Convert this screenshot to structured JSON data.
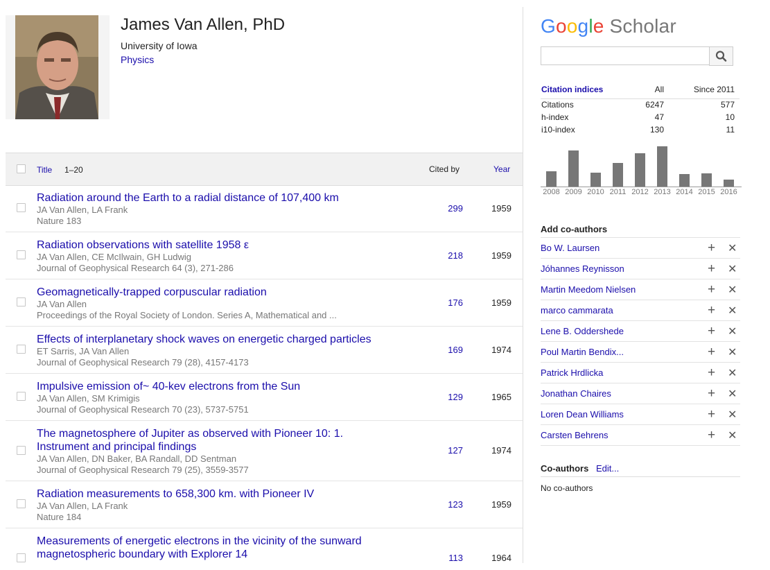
{
  "profile": {
    "name": "James Van Allen",
    "suffix": ", PhD",
    "affiliation": "University of Iowa",
    "field": "Physics"
  },
  "table_header": {
    "title": "Title",
    "range": "1–20",
    "cited_by": "Cited by",
    "year": "Year"
  },
  "articles": [
    {
      "title": "Radiation around the Earth to a radial distance of 107,400 km",
      "authors": "JA Van Allen, LA Frank",
      "venue": "Nature 183",
      "cited": "299",
      "year": "1959"
    },
    {
      "title": "Radiation observations with satellite 1958 ε",
      "authors": "JA Van Allen, CE McIlwain, GH Ludwig",
      "venue": "Journal of Geophysical Research 64 (3), 271-286",
      "cited": "218",
      "year": "1959"
    },
    {
      "title": "Geomagnetically-trapped corpuscular radiation",
      "authors": "JA Van Allen",
      "venue": "Proceedings of the Royal Society of London. Series A, Mathematical and ...",
      "cited": "176",
      "year": "1959"
    },
    {
      "title": "Effects of interplanetary shock waves on energetic charged particles",
      "authors": "ET Sarris, JA Van Allen",
      "venue": "Journal of Geophysical Research 79 (28), 4157-4173",
      "cited": "169",
      "year": "1974"
    },
    {
      "title": "Impulsive emission of~ 40-kev electrons from the Sun",
      "authors": "JA Van Allen, SM Krimigis",
      "venue": "Journal of Geophysical Research 70 (23), 5737-5751",
      "cited": "129",
      "year": "1965"
    },
    {
      "title": "The magnetosphere of Jupiter as observed with Pioneer 10: 1. Instrument and principal findings",
      "authors": "JA Van Allen, DN Baker, BA Randall, DD Sentman",
      "venue": "Journal of Geophysical Research 79 (25), 3559-3577",
      "cited": "127",
      "year": "1974"
    },
    {
      "title": "Radiation measurements to 658,300 km. with Pioneer IV",
      "authors": "JA Van Allen, LA Frank",
      "venue": "Nature 184",
      "cited": "123",
      "year": "1959"
    },
    {
      "title": "Measurements of energetic electrons in the vicinity of the sunward magnetospheric boundary with Explorer 14",
      "authors": "",
      "venue": "",
      "cited": "113",
      "year": "1964"
    }
  ],
  "logo": {
    "google": "Google",
    "scholar": "Scholar"
  },
  "search": {
    "placeholder": ""
  },
  "citation_indices": {
    "heading": "Citation indices",
    "col_all": "All",
    "col_since": "Since 2011",
    "rows": [
      {
        "label": "Citations",
        "all": "6247",
        "since": "577"
      },
      {
        "label": "h-index",
        "all": "47",
        "since": "10"
      },
      {
        "label": "i10-index",
        "all": "130",
        "since": "11"
      }
    ]
  },
  "chart_data": {
    "type": "bar",
    "categories": [
      "2008",
      "2009",
      "2010",
      "2011",
      "2012",
      "2013",
      "2014",
      "2015",
      "2016"
    ],
    "values": [
      22,
      52,
      20,
      34,
      48,
      58,
      18,
      19,
      10
    ],
    "bar_color": "#777777"
  },
  "add_coauthors": {
    "heading": "Add co-authors",
    "people": [
      "Bo W. Laursen",
      "Jóhannes Reynisson",
      "Martin Meedom Nielsen",
      "marco cammarata",
      "Lene B. Oddershede",
      "Poul Martin Bendix...",
      "Patrick Hrdlicka",
      "Jonathan Chaires",
      "Loren Dean Williams",
      "Carsten Behrens"
    ]
  },
  "coauthors": {
    "heading": "Co-authors",
    "edit": "Edit...",
    "empty": "No co-authors"
  },
  "colors": {
    "link": "#1a0dab",
    "g_blue": "#4285f4",
    "g_red": "#ea4335",
    "g_yellow": "#fbbc05",
    "g_green": "#34a853"
  }
}
